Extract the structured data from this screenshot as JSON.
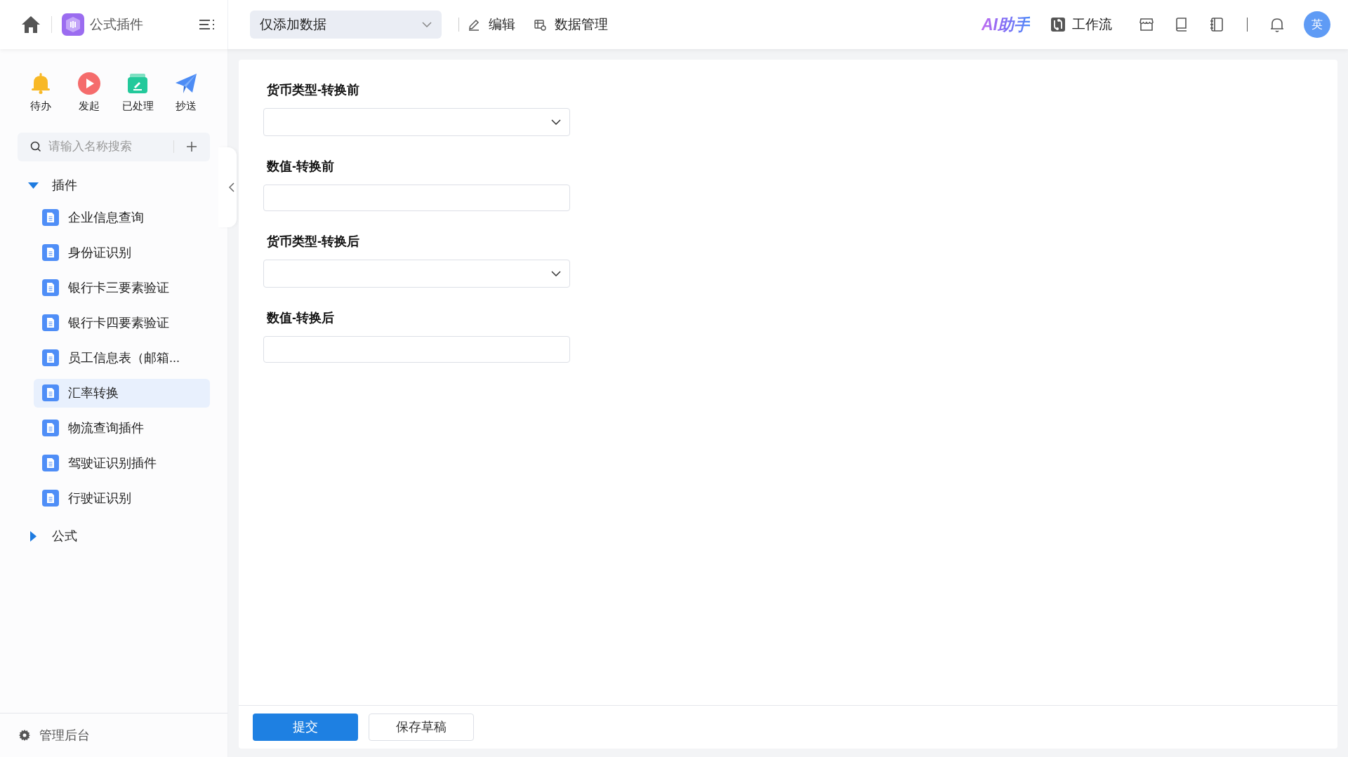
{
  "header": {
    "app_title": "公式插件",
    "mode_select": {
      "value": "仅添加数据"
    },
    "actions": [
      {
        "label": "编辑",
        "kind": "edit"
      },
      {
        "label": "数据管理",
        "kind": "data"
      }
    ],
    "ai_label": "AI助手",
    "workflow": "工作流",
    "avatar": "英"
  },
  "quick_actions": [
    {
      "label": "待办",
      "kind": "bell"
    },
    {
      "label": "发起",
      "kind": "play"
    },
    {
      "label": "已处理",
      "kind": "done"
    },
    {
      "label": "抄送",
      "kind": "send"
    }
  ],
  "search": {
    "placeholder": "请输入名称搜索"
  },
  "tree": [
    {
      "label": "插件",
      "expanded": true,
      "children": [
        {
          "label": "企业信息查询",
          "selected": false
        },
        {
          "label": "身份证识别",
          "selected": false
        },
        {
          "label": "银行卡三要素验证",
          "selected": false
        },
        {
          "label": "银行卡四要素验证",
          "selected": false
        },
        {
          "label": "员工信息表（邮箱...",
          "selected": false
        },
        {
          "label": "汇率转换",
          "selected": true
        },
        {
          "label": "物流查询插件",
          "selected": false
        },
        {
          "label": "驾驶证识别插件",
          "selected": false
        },
        {
          "label": "行驶证识别",
          "selected": false
        }
      ]
    },
    {
      "label": "公式",
      "expanded": false
    }
  ],
  "admin": "管理后台",
  "form": {
    "fields": [
      {
        "label": "货币类型-转换前",
        "kind": "select"
      },
      {
        "label": "数值-转换前",
        "kind": "input"
      },
      {
        "label": "货币类型-转换后",
        "kind": "select"
      },
      {
        "label": "数值-转换后",
        "kind": "input"
      }
    ]
  },
  "buttons": [
    {
      "label": "提交",
      "kind": "primary"
    },
    {
      "label": "保存草稿",
      "kind": "default"
    }
  ]
}
